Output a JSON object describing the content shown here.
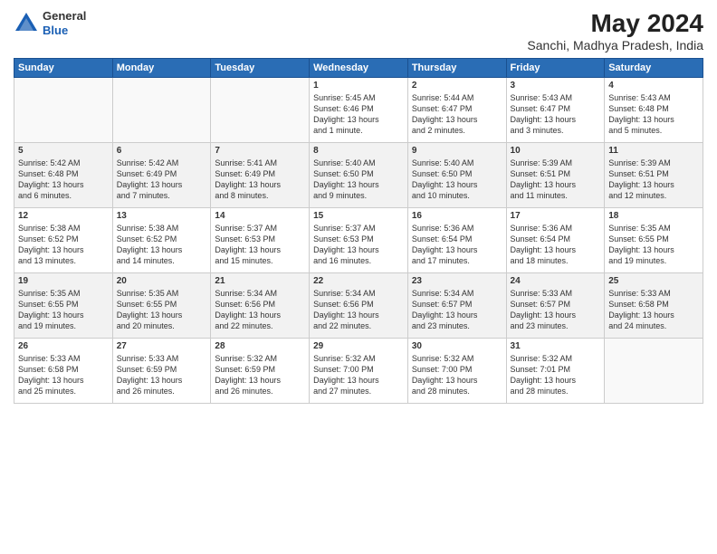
{
  "header": {
    "logo_line1": "General",
    "logo_line2": "Blue",
    "title": "May 2024",
    "subtitle": "Sanchi, Madhya Pradesh, India"
  },
  "days_of_week": [
    "Sunday",
    "Monday",
    "Tuesday",
    "Wednesday",
    "Thursday",
    "Friday",
    "Saturday"
  ],
  "weeks": [
    {
      "cells": [
        {
          "day": "",
          "content": ""
        },
        {
          "day": "",
          "content": ""
        },
        {
          "day": "",
          "content": ""
        },
        {
          "day": "1",
          "content": "Sunrise: 5:45 AM\nSunset: 6:46 PM\nDaylight: 13 hours\nand 1 minute."
        },
        {
          "day": "2",
          "content": "Sunrise: 5:44 AM\nSunset: 6:47 PM\nDaylight: 13 hours\nand 2 minutes."
        },
        {
          "day": "3",
          "content": "Sunrise: 5:43 AM\nSunset: 6:47 PM\nDaylight: 13 hours\nand 3 minutes."
        },
        {
          "day": "4",
          "content": "Sunrise: 5:43 AM\nSunset: 6:48 PM\nDaylight: 13 hours\nand 5 minutes."
        }
      ]
    },
    {
      "cells": [
        {
          "day": "5",
          "content": "Sunrise: 5:42 AM\nSunset: 6:48 PM\nDaylight: 13 hours\nand 6 minutes."
        },
        {
          "day": "6",
          "content": "Sunrise: 5:42 AM\nSunset: 6:49 PM\nDaylight: 13 hours\nand 7 minutes."
        },
        {
          "day": "7",
          "content": "Sunrise: 5:41 AM\nSunset: 6:49 PM\nDaylight: 13 hours\nand 8 minutes."
        },
        {
          "day": "8",
          "content": "Sunrise: 5:40 AM\nSunset: 6:50 PM\nDaylight: 13 hours\nand 9 minutes."
        },
        {
          "day": "9",
          "content": "Sunrise: 5:40 AM\nSunset: 6:50 PM\nDaylight: 13 hours\nand 10 minutes."
        },
        {
          "day": "10",
          "content": "Sunrise: 5:39 AM\nSunset: 6:51 PM\nDaylight: 13 hours\nand 11 minutes."
        },
        {
          "day": "11",
          "content": "Sunrise: 5:39 AM\nSunset: 6:51 PM\nDaylight: 13 hours\nand 12 minutes."
        }
      ]
    },
    {
      "cells": [
        {
          "day": "12",
          "content": "Sunrise: 5:38 AM\nSunset: 6:52 PM\nDaylight: 13 hours\nand 13 minutes."
        },
        {
          "day": "13",
          "content": "Sunrise: 5:38 AM\nSunset: 6:52 PM\nDaylight: 13 hours\nand 14 minutes."
        },
        {
          "day": "14",
          "content": "Sunrise: 5:37 AM\nSunset: 6:53 PM\nDaylight: 13 hours\nand 15 minutes."
        },
        {
          "day": "15",
          "content": "Sunrise: 5:37 AM\nSunset: 6:53 PM\nDaylight: 13 hours\nand 16 minutes."
        },
        {
          "day": "16",
          "content": "Sunrise: 5:36 AM\nSunset: 6:54 PM\nDaylight: 13 hours\nand 17 minutes."
        },
        {
          "day": "17",
          "content": "Sunrise: 5:36 AM\nSunset: 6:54 PM\nDaylight: 13 hours\nand 18 minutes."
        },
        {
          "day": "18",
          "content": "Sunrise: 5:35 AM\nSunset: 6:55 PM\nDaylight: 13 hours\nand 19 minutes."
        }
      ]
    },
    {
      "cells": [
        {
          "day": "19",
          "content": "Sunrise: 5:35 AM\nSunset: 6:55 PM\nDaylight: 13 hours\nand 19 minutes."
        },
        {
          "day": "20",
          "content": "Sunrise: 5:35 AM\nSunset: 6:55 PM\nDaylight: 13 hours\nand 20 minutes."
        },
        {
          "day": "21",
          "content": "Sunrise: 5:34 AM\nSunset: 6:56 PM\nDaylight: 13 hours\nand 22 minutes."
        },
        {
          "day": "22",
          "content": "Sunrise: 5:34 AM\nSunset: 6:56 PM\nDaylight: 13 hours\nand 22 minutes."
        },
        {
          "day": "23",
          "content": "Sunrise: 5:34 AM\nSunset: 6:57 PM\nDaylight: 13 hours\nand 23 minutes."
        },
        {
          "day": "24",
          "content": "Sunrise: 5:33 AM\nSunset: 6:57 PM\nDaylight: 13 hours\nand 23 minutes."
        },
        {
          "day": "25",
          "content": "Sunrise: 5:33 AM\nSunset: 6:58 PM\nDaylight: 13 hours\nand 24 minutes."
        }
      ]
    },
    {
      "cells": [
        {
          "day": "26",
          "content": "Sunrise: 5:33 AM\nSunset: 6:58 PM\nDaylight: 13 hours\nand 25 minutes."
        },
        {
          "day": "27",
          "content": "Sunrise: 5:33 AM\nSunset: 6:59 PM\nDaylight: 13 hours\nand 26 minutes."
        },
        {
          "day": "28",
          "content": "Sunrise: 5:32 AM\nSunset: 6:59 PM\nDaylight: 13 hours\nand 26 minutes."
        },
        {
          "day": "29",
          "content": "Sunrise: 5:32 AM\nSunset: 7:00 PM\nDaylight: 13 hours\nand 27 minutes."
        },
        {
          "day": "30",
          "content": "Sunrise: 5:32 AM\nSunset: 7:00 PM\nDaylight: 13 hours\nand 28 minutes."
        },
        {
          "day": "31",
          "content": "Sunrise: 5:32 AM\nSunset: 7:01 PM\nDaylight: 13 hours\nand 28 minutes."
        },
        {
          "day": "",
          "content": ""
        }
      ]
    }
  ]
}
